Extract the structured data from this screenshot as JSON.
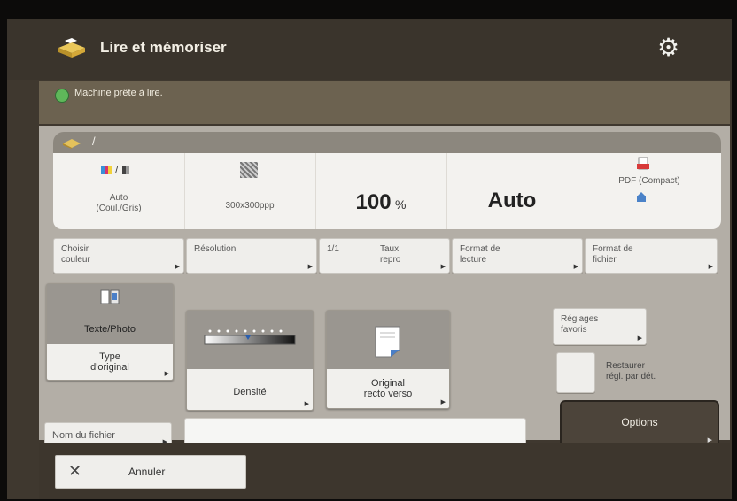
{
  "header": {
    "title": "Lire et mémoriser",
    "app_icon": "scan-and-store-icon",
    "settings_icon": "gear-icon"
  },
  "status": {
    "text": "Machine prête à lire.",
    "color": "#5fb75a"
  },
  "panel_tab": {
    "separator": "/"
  },
  "summary": {
    "color_mode": {
      "line1": "Auto",
      "line2": "(Coul./Gris)"
    },
    "resolution": "300x300ppp",
    "zoom": {
      "value": "100",
      "unit": "%"
    },
    "scan_size": "Auto",
    "file_format": "PDF (Compact)"
  },
  "settings_buttons": {
    "color": {
      "line1": "Choisir",
      "line2": "couleur"
    },
    "resolution": "Résolution",
    "zoom": {
      "ratio": "1/1",
      "line1": "Taux",
      "line2": "repro"
    },
    "scan_size": {
      "line1": "Format de",
      "line2": "lecture"
    },
    "file_format": {
      "line1": "Format de",
      "line2": "fichier"
    }
  },
  "original_type": {
    "value": "Texte/Photo",
    "line1": "Type",
    "line2": "d'original"
  },
  "density": {
    "label": "Densité"
  },
  "duplex": {
    "line1": "Original",
    "line2": "recto verso"
  },
  "favorites": {
    "line1": "Réglages",
    "line2": "favoris"
  },
  "restore": {
    "line1": "Restaurer",
    "line2": "régl. par dét."
  },
  "filename": {
    "button": "Nom du fichier",
    "value": ""
  },
  "options": {
    "label": "Options"
  },
  "cancel": {
    "label": "Annuler",
    "icon": "close-icon"
  },
  "colors": {
    "title_bar": "#3a342c",
    "status_bar": "#6c6250",
    "panel": "#b3aea6",
    "options": "#4c443a"
  }
}
